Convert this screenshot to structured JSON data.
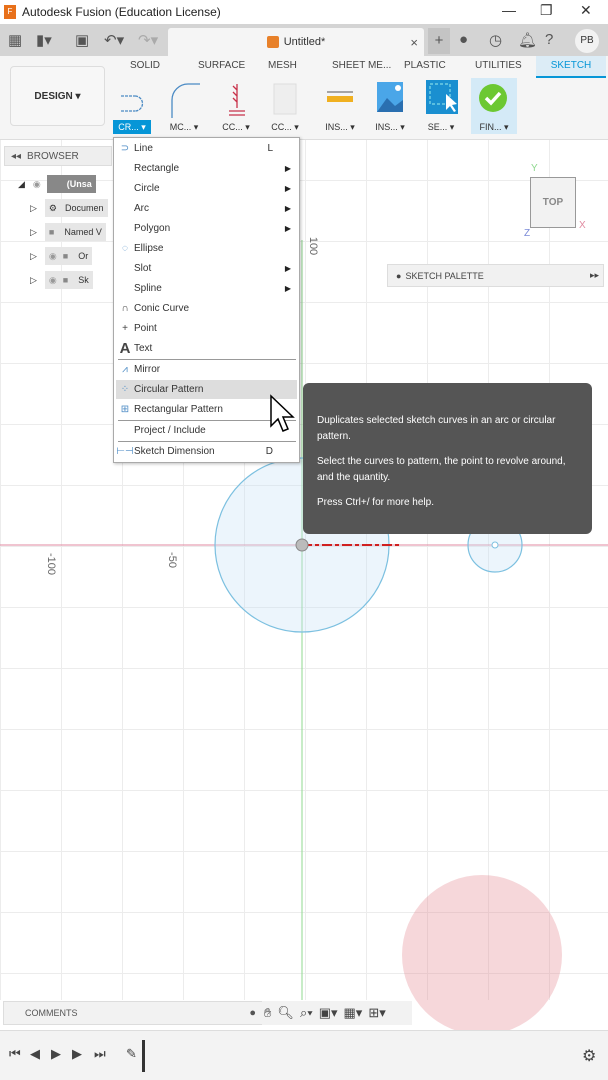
{
  "window": {
    "title": "Autodesk Fusion (Education License)",
    "minimize": "—",
    "maximize": "❐",
    "close": "✕",
    "logo": "F"
  },
  "qat": {
    "doc_tab": "Untitled*",
    "doc_close": "×",
    "avatar": "PB",
    "icons": [
      "apps-grid-icon",
      "file-icon",
      "save-icon",
      "undo-icon",
      "redo-icon",
      "new-tab-icon",
      "extensions-icon",
      "job-status-icon",
      "notifications-icon",
      "help-icon"
    ]
  },
  "ribbon": {
    "workspace": "DESIGN ▾",
    "tabs": [
      "SOLID",
      "SURFACE",
      "MESH",
      "SHEET ME...",
      "PLASTIC",
      "UTILITIES",
      "SKETCH"
    ],
    "active_tab": "SKETCH",
    "tools": [
      {
        "label": "CR... ▾",
        "icon": "create-sketch-icon"
      },
      {
        "label": "MC... ▾",
        "icon": "modify-fillet-icon"
      },
      {
        "label": "CC... ▾",
        "icon": "constraints-icon"
      },
      {
        "label": "CC... ▾",
        "icon": "configure-icon"
      },
      {
        "label": "INS... ▾",
        "icon": "inspect-measure-icon"
      },
      {
        "label": "INS... ▾",
        "icon": "insert-image-icon"
      },
      {
        "label": "SE... ▾",
        "icon": "select-icon"
      },
      {
        "label": "FIN... ▾",
        "icon": "finish-sketch-icon"
      }
    ],
    "accent": "#0696d7"
  },
  "browser": {
    "title": "BROWSER",
    "items": [
      "(Unsa",
      "Documen",
      "Named V",
      "Or",
      "Sk"
    ]
  },
  "menu": {
    "items": [
      {
        "label": "Line",
        "shortcut": "L",
        "icon": "line-icon"
      },
      {
        "label": "Rectangle",
        "submenu": true
      },
      {
        "label": "Circle",
        "submenu": true
      },
      {
        "label": "Arc",
        "submenu": true
      },
      {
        "label": "Polygon",
        "submenu": true
      },
      {
        "label": "Ellipse",
        "icon": "ellipse-icon"
      },
      {
        "label": "Slot",
        "submenu": true
      },
      {
        "label": "Spline",
        "submenu": true
      },
      {
        "label": "Conic Curve",
        "icon": "conic-curve-icon"
      },
      {
        "label": "Point",
        "icon": "point-icon"
      },
      {
        "label": "Text",
        "icon": "text-icon"
      },
      {
        "label": "Mirror",
        "icon": "mirror-icon"
      },
      {
        "label": "Circular Pattern",
        "icon": "circular-pattern-icon",
        "highlighted": true
      },
      {
        "label": "Rectangular Pattern",
        "icon": "rectangular-pattern-icon"
      },
      {
        "label": "Project / Include"
      },
      {
        "label": "Sketch Dimension",
        "shortcut": "D",
        "icon": "sketch-dimension-icon"
      }
    ]
  },
  "tooltip": {
    "line1": "Duplicates selected sketch curves in an arc or circular pattern.",
    "line2": "Select the curves to pattern, the point to revolve around, and the quantity.",
    "line3": "Press Ctrl+/ for more help."
  },
  "palette": {
    "title": "SKETCH PALETTE",
    "expand": "▸▸"
  },
  "viewcube": {
    "face": "TOP",
    "axis_x": "X",
    "axis_y": "Y",
    "axis_z": "Z"
  },
  "canvas": {
    "ruler_labels": [
      "100",
      "-100",
      "-50"
    ]
  },
  "comments": {
    "title": "COMMENTS"
  },
  "timeline": {
    "settings_icon": "gear-icon"
  }
}
